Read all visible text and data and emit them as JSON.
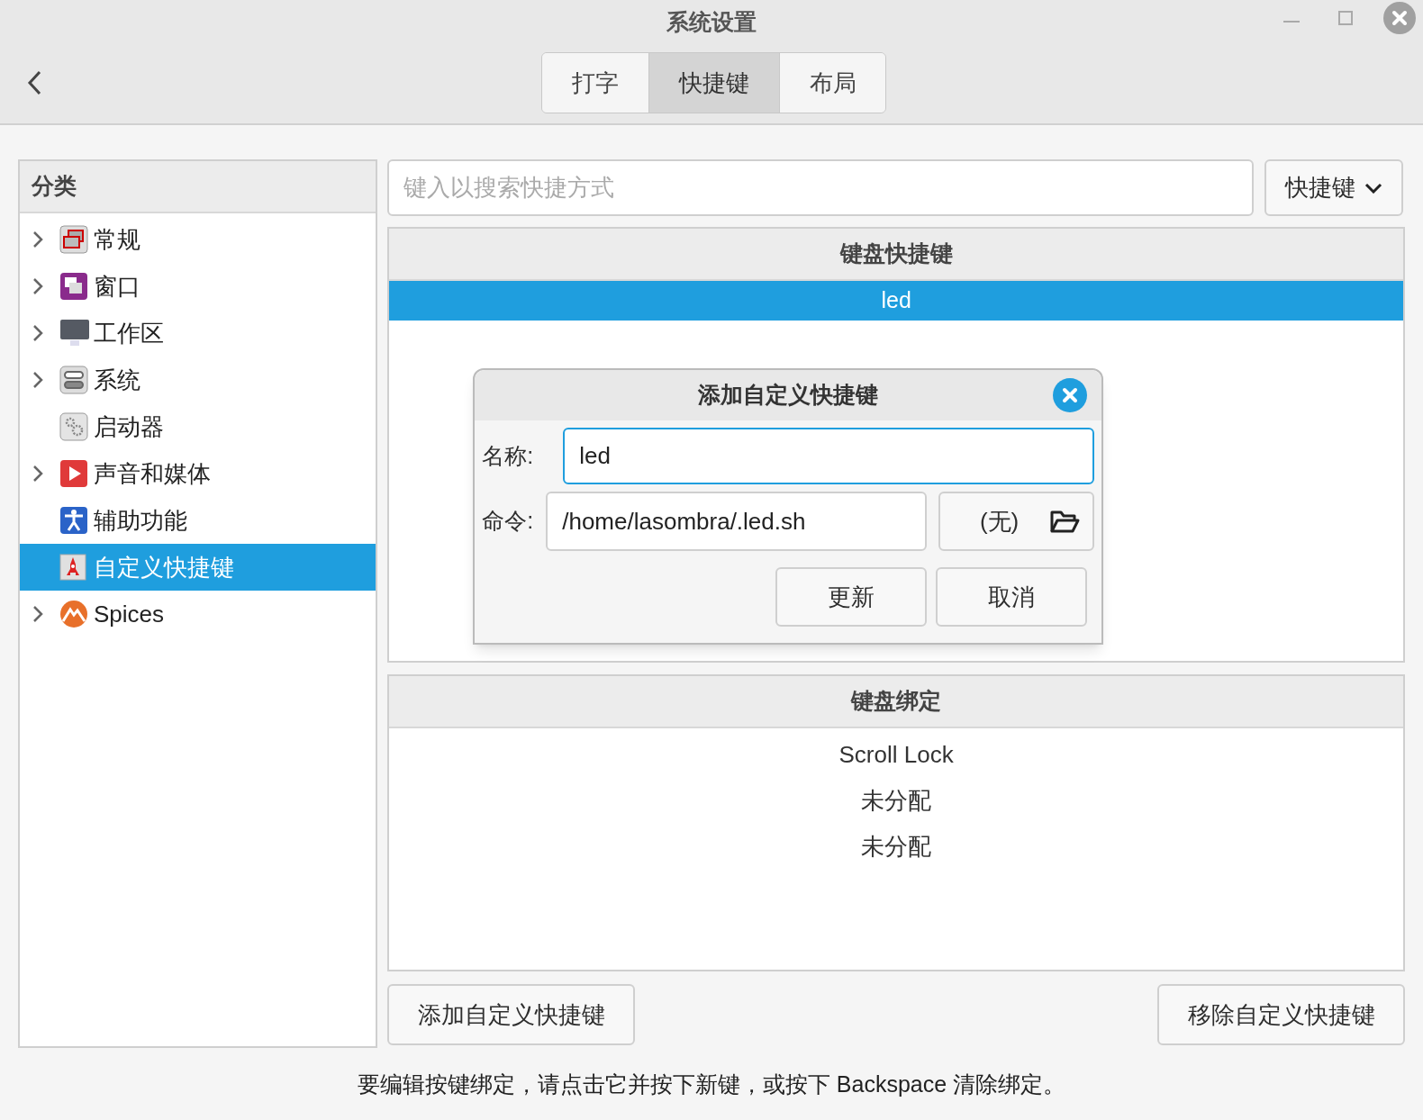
{
  "window": {
    "title": "系统设置"
  },
  "tabs": [
    {
      "label": "打字",
      "selected": false
    },
    {
      "label": "快捷键",
      "selected": true
    },
    {
      "label": "布局",
      "selected": false
    }
  ],
  "sidebar": {
    "title": "分类",
    "items": [
      {
        "label": "常规",
        "expandable": true,
        "selected": false
      },
      {
        "label": "窗口",
        "expandable": true,
        "selected": false
      },
      {
        "label": "工作区",
        "expandable": true,
        "selected": false
      },
      {
        "label": "系统",
        "expandable": true,
        "selected": false
      },
      {
        "label": "启动器",
        "expandable": false,
        "selected": false
      },
      {
        "label": "声音和媒体",
        "expandable": true,
        "selected": false
      },
      {
        "label": "辅助功能",
        "expandable": false,
        "selected": false
      },
      {
        "label": "自定义快捷键",
        "expandable": false,
        "selected": true
      },
      {
        "label": "Spices",
        "expandable": true,
        "selected": false
      }
    ]
  },
  "search": {
    "placeholder": "键入以搜索快捷方式"
  },
  "filter_dropdown": {
    "label": "快捷键"
  },
  "shortcuts": {
    "title": "键盘快捷键",
    "rows": [
      {
        "label": "led",
        "selected": true
      }
    ]
  },
  "dialog": {
    "title": "添加自定义快捷键",
    "name_label": "名称:",
    "name_value": "led",
    "command_label": "命令:",
    "command_value": "/home/lasombra/.led.sh",
    "file_chooser": "(无)",
    "buttons": [
      "更新",
      "取消"
    ]
  },
  "bindings": {
    "title": "键盘绑定",
    "rows": [
      "Scroll Lock",
      "未分配",
      "未分配"
    ]
  },
  "buttons": {
    "add": "添加自定义快捷键",
    "remove": "移除自定义快捷键"
  },
  "hint": "要编辑按键绑定，请点击它并按下新键，或按下 Backspace 清除绑定。"
}
